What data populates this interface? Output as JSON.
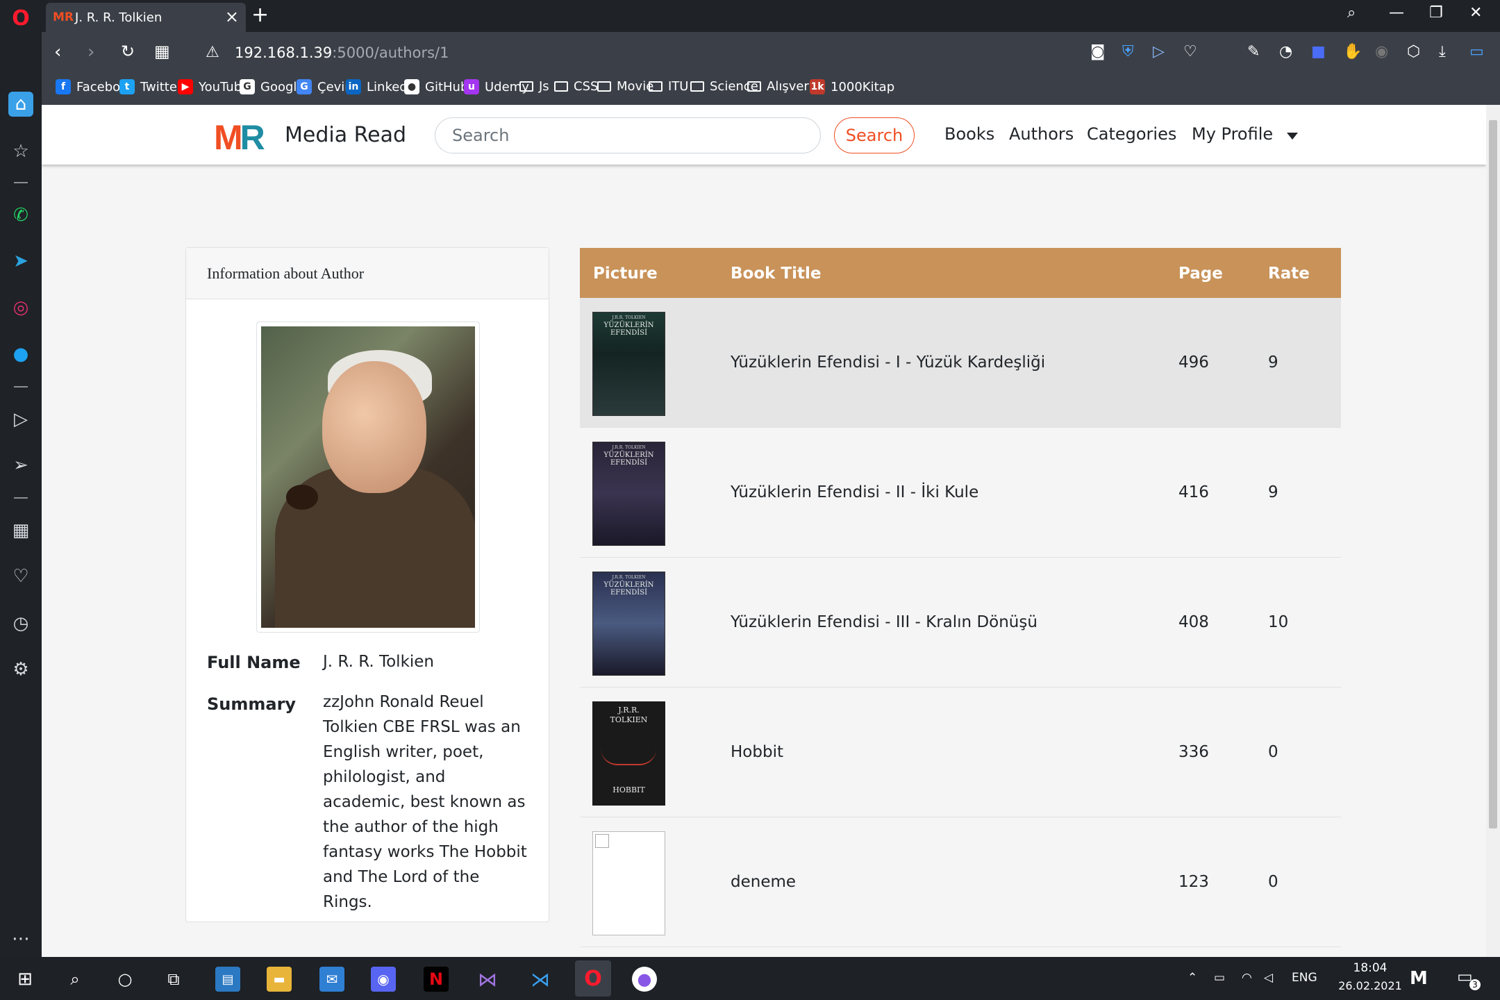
{
  "browser": {
    "tab_title": "J. R. R. Tolkien",
    "tab_logo": "MR",
    "url_host": "192.168.1.39",
    "url_path": ":5000/authors/1",
    "bookmarks": [
      {
        "label": "Facebook",
        "icon": "facebook-icon",
        "color": "#1877f2",
        "glyph": "f"
      },
      {
        "label": "Twitter",
        "icon": "twitter-icon",
        "color": "#1da1f2",
        "glyph": "t"
      },
      {
        "label": "YouTube",
        "icon": "youtube-icon",
        "color": "#ff0000",
        "glyph": "▶"
      },
      {
        "label": "Google",
        "icon": "google-icon",
        "color": "#ffffff",
        "glyph": "G"
      },
      {
        "label": "Çeviri",
        "icon": "translate-icon",
        "color": "#4285f4",
        "glyph": "G"
      },
      {
        "label": "LinkedIn",
        "icon": "linkedin-icon",
        "color": "#0a66c2",
        "glyph": "in"
      },
      {
        "label": "GitHub",
        "icon": "github-icon",
        "color": "#ffffff",
        "glyph": "●"
      },
      {
        "label": "Udemy",
        "icon": "udemy-icon",
        "color": "#a435f0",
        "glyph": "u"
      },
      {
        "label": "Js",
        "icon": "folder-icon",
        "color": "",
        "glyph": ""
      },
      {
        "label": "CSS",
        "icon": "folder-icon",
        "color": "",
        "glyph": ""
      },
      {
        "label": "Movie",
        "icon": "folder-icon",
        "color": "",
        "glyph": ""
      },
      {
        "label": "ITU",
        "icon": "folder-icon",
        "color": "",
        "glyph": ""
      },
      {
        "label": "Science",
        "icon": "folder-icon",
        "color": "",
        "glyph": ""
      },
      {
        "label": "Alışveriş",
        "icon": "folder-icon",
        "color": "",
        "glyph": ""
      },
      {
        "label": "1000Kitap",
        "icon": "kitap-icon",
        "color": "#c0392b",
        "glyph": "1k"
      }
    ]
  },
  "navbar": {
    "brand": "Media Read",
    "logo_m": "M",
    "logo_r": "R",
    "search_placeholder": "Search",
    "search_button": "Search",
    "links": [
      "Books",
      "Authors",
      "Categories",
      "My Profile"
    ]
  },
  "author_card": {
    "header": "Information about Author",
    "full_name_label": "Full Name",
    "full_name": "J. R. R. Tolkien",
    "summary_label": "Summary",
    "summary": "zzJohn Ronald Reuel Tolkien CBE FRSL was an English writer, poet, philologist, and academic, best known as the author of the high fantasy works The Hobbit and The Lord of the Rings."
  },
  "books_table": {
    "headers": [
      "Picture",
      "Book Title",
      "Page",
      "Rate"
    ],
    "rows": [
      {
        "title": "Yüzüklerin Efendisi - I - Yüzük Kardeşliği",
        "page": "496",
        "rate": "9",
        "cover": "lotr1",
        "highlight": true
      },
      {
        "title": "Yüzüklerin Efendisi - II - İki Kule",
        "page": "416",
        "rate": "9",
        "cover": "lotr2",
        "highlight": false
      },
      {
        "title": "Yüzüklerin Efendisi - III - Kralın Dönüşü",
        "page": "408",
        "rate": "10",
        "cover": "lotr3",
        "highlight": false
      },
      {
        "title": "Hobbit",
        "page": "336",
        "rate": "0",
        "cover": "hobbit",
        "highlight": false
      },
      {
        "title": "deneme",
        "page": "123",
        "rate": "0",
        "cover": "broken",
        "highlight": false
      }
    ]
  },
  "covers": {
    "lotr_author": "J.R.R. TOLKIEN",
    "lotr_title": "YÜZÜKLERİN EFENDİSİ",
    "hobbit_author": "J.R.R. TOLKIEN",
    "hobbit_title": "HOBBIT"
  },
  "taskbar": {
    "lang": "ENG",
    "time": "18:04",
    "date": "26.02.2021",
    "notif_count": "3"
  }
}
